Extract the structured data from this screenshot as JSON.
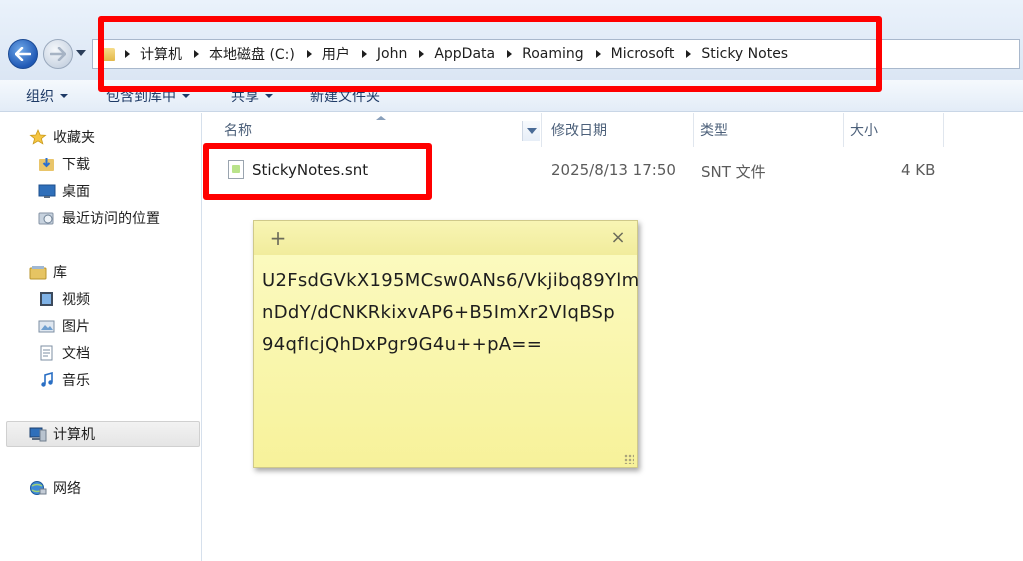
{
  "address": {
    "crumbs": [
      "计算机",
      "本地磁盘 (C:)",
      "用户",
      "John",
      "AppData",
      "Roaming",
      "Microsoft",
      "Sticky Notes"
    ]
  },
  "toolbar": {
    "organize": "组织",
    "include_library": "包含到库中",
    "share": "共享",
    "new_folder": "新建文件夹"
  },
  "nav": {
    "favorites": "收藏夹",
    "downloads": "下载",
    "desktop": "桌面",
    "recent": "最近访问的位置",
    "libraries": "库",
    "videos": "视频",
    "pictures": "图片",
    "documents": "文档",
    "music": "音乐",
    "computer": "计算机",
    "network": "网络"
  },
  "columns": {
    "name": "名称",
    "modified": "修改日期",
    "type": "类型",
    "size": "大小"
  },
  "files": [
    {
      "name": "StickyNotes.snt",
      "modified": "2025/8/13 17:50",
      "type": "SNT 文件",
      "size": "4 KB"
    }
  ],
  "sticky": {
    "add_symbol": "+",
    "close_symbol": "×",
    "lines": [
      "U2FsdGVkX195MCsw0ANs6/Vkjibq89Ylm",
      "nDdY/dCNKRkixvAP6+B5ImXr2VIqBSp",
      "94qfIcjQhDxPgr9G4u++pA=="
    ]
  },
  "colors": {
    "highlight": "#ff0000",
    "sticky_bg": "#f8f4a8"
  }
}
